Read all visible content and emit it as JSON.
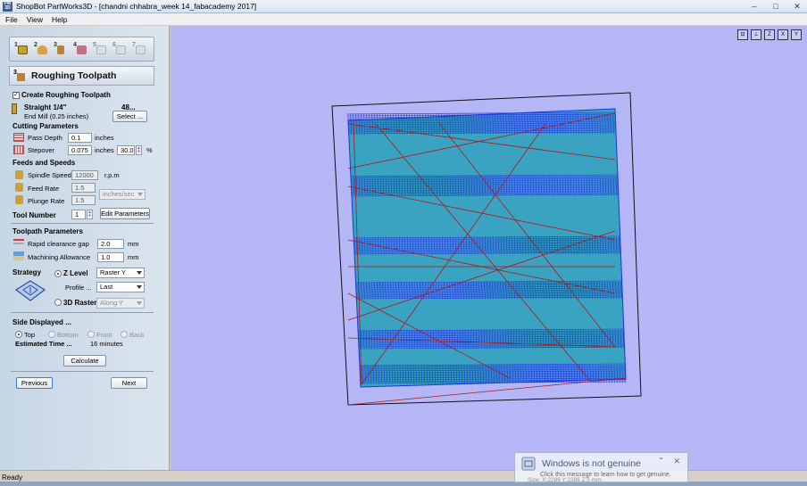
{
  "window": {
    "app_icon": "PW 3D",
    "title": "ShopBot PartWorks3D - [chandni chhabra_week 14_fabacademy 2017]",
    "controls": [
      "–",
      "□",
      "✕"
    ]
  },
  "menu": [
    "File",
    "View",
    "Help"
  ],
  "tool_strip": {
    "steps": [
      "1",
      "2",
      "3",
      "4",
      "5",
      "6",
      "7"
    ]
  },
  "section": {
    "number": "3",
    "title": "Roughing Toolpath"
  },
  "create": {
    "checked": "✓",
    "label": "Create Roughing Toolpath"
  },
  "tool": {
    "name": "Straight 1/4\"",
    "number_prefix": "48...",
    "description": "End Mill (0.25 inches)",
    "select_label": "Select ..."
  },
  "cutting": {
    "header": "Cutting Parameters",
    "pass_depth_label": "Pass Depth",
    "pass_depth_value": "0.1",
    "pass_depth_unit": "inches",
    "stepover_label": "Stepover",
    "stepover_value": "0.075",
    "stepover_unit": "inches",
    "stepover_percent": "30.0",
    "percent_sign": "%"
  },
  "feeds": {
    "header": "Feeds and Speeds",
    "spindle_label": "Spindle Speed",
    "spindle_value": "12000",
    "spindle_unit": "r.p.m",
    "feed_label": "Feed Rate",
    "feed_value": "1.5",
    "rate_unit": "inches/sec",
    "plunge_label": "Plunge Rate",
    "plunge_value": "1.5"
  },
  "tool_number": {
    "label": "Tool Number",
    "value": "1",
    "edit_label": "Edit Parameters"
  },
  "toolpath": {
    "header": "Toolpath Parameters",
    "rapid_label": "Rapid clearance gap",
    "rapid_value": "2.0",
    "rapid_unit": "mm",
    "allowance_label": "Machining Allowance",
    "allowance_value": "1.0",
    "allowance_unit": "mm"
  },
  "strategy": {
    "label": "Strategy",
    "zlevel_label": "Z Level",
    "zlevel_select": "Raster Y",
    "profile_label": "Profile ...",
    "profile_select": "Last",
    "raster3d_label": "3D Raster",
    "raster3d_select": "Along Y"
  },
  "side": {
    "header": "Side Displayed ...",
    "options": [
      "Top",
      "Bottom",
      "Front",
      "Back"
    ]
  },
  "estimate": {
    "label": "Estimated Time ...",
    "value": "16 minutes"
  },
  "buttons": {
    "calculate": "Calculate",
    "previous": "Previous",
    "next": "Next"
  },
  "view_tools": [
    "⊡",
    "⊥",
    "Z",
    "X",
    "Y"
  ],
  "status": "Ready",
  "notice": {
    "title": "Windows is not genuine",
    "subtitle": "Click this message to learn how to get genuine.",
    "size_text": "Size: X:2286 Y:2286 Z:5 mm",
    "close": "✕"
  },
  "colors": {
    "viewport_bg": "#b4b6f5",
    "model_fill": "#3aa3c2",
    "raster_blue": "#1f35d8",
    "path_red": "#b01818",
    "panel_bg": "#d0dce8"
  }
}
